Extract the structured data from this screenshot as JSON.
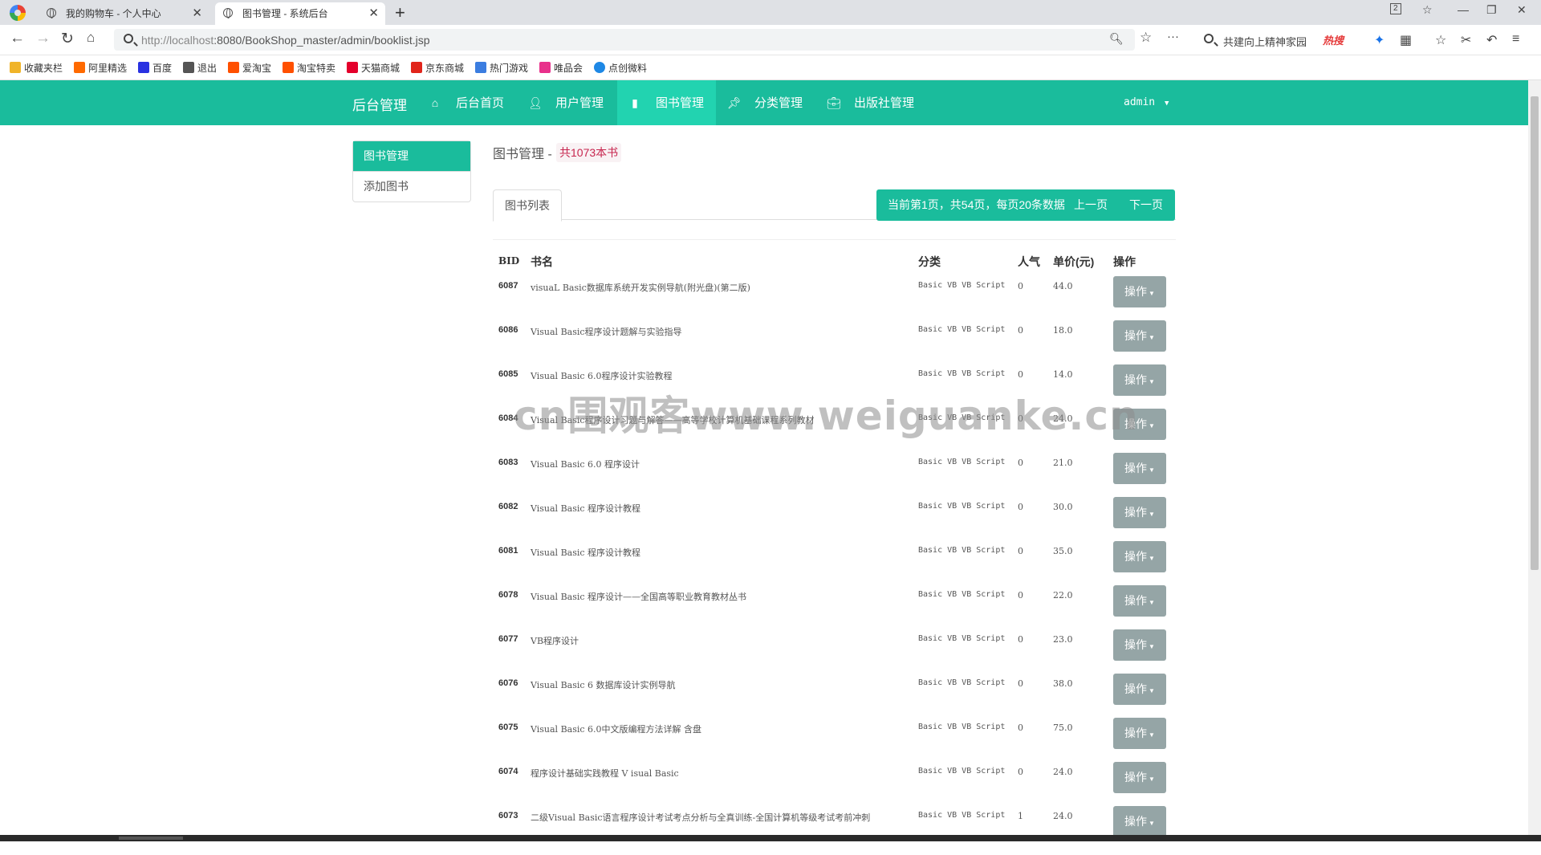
{
  "browser": {
    "tabs": [
      {
        "title": "我的购物车 - 个人中心",
        "active": false
      },
      {
        "title": "图书管理 - 系统后台",
        "active": true
      }
    ],
    "url_host": "http://localhost",
    "url_path": ":8080/BookShop_master/admin/booklist.jsp",
    "tab_count": "2",
    "search_hint": "共建向上精神家园",
    "hot_label": "热搜",
    "bookmarks": [
      {
        "label": "收藏夹栏",
        "color": "#f0b429"
      },
      {
        "label": "阿里精选",
        "color": "#ff6a00"
      },
      {
        "label": "百度",
        "color": "#2932e1"
      },
      {
        "label": "退出",
        "color": "#555555"
      },
      {
        "label": "爱淘宝",
        "color": "#ff5000"
      },
      {
        "label": "淘宝特卖",
        "color": "#ff5000"
      },
      {
        "label": "天猫商城",
        "color": "#e4002b"
      },
      {
        "label": "京东商城",
        "color": "#e1251b"
      },
      {
        "label": "热门游戏",
        "color": "#3b7de0"
      },
      {
        "label": "唯品会",
        "color": "#e8318b"
      },
      {
        "label": "点创微料",
        "color": "#1e88e5"
      }
    ]
  },
  "nav": {
    "brand": "后台管理",
    "items": [
      {
        "label": "后台首页",
        "icon": "home-icon"
      },
      {
        "label": "用户管理",
        "icon": "user-icon"
      },
      {
        "label": "图书管理",
        "icon": "book-icon"
      },
      {
        "label": "分类管理",
        "icon": "pushpin-icon"
      },
      {
        "label": "出版社管理",
        "icon": "briefcase-icon"
      }
    ],
    "user": "admin"
  },
  "sidebar": {
    "items": [
      {
        "label": "图书管理",
        "active": true
      },
      {
        "label": "添加图书",
        "active": false
      }
    ]
  },
  "main": {
    "title": "图书管理 -",
    "count": "共1073本书",
    "tab": "图书列表",
    "pager": {
      "info": "当前第1页，共54页，每页20条数据",
      "prev": "上一页",
      "next": "下一页"
    }
  },
  "table": {
    "headers": {
      "bid": "BID",
      "name": "书名",
      "category": "分类",
      "popularity": "人气",
      "price": "单价(元)",
      "op": "操作"
    },
    "op_label": "操作",
    "rows": [
      {
        "bid": "6087",
        "name": "visuaL Basic数据库系统开发实例导航(附光盘)(第二版)",
        "category": "Basic VB VB Script",
        "popularity": "0",
        "price": "44.0"
      },
      {
        "bid": "6086",
        "name": "Visual Basic程序设计题解与实验指导",
        "category": "Basic VB VB Script",
        "popularity": "0",
        "price": "18.0"
      },
      {
        "bid": "6085",
        "name": "Visual Basic 6.0程序设计实验教程",
        "category": "Basic VB VB Script",
        "popularity": "0",
        "price": "14.0"
      },
      {
        "bid": "6084",
        "name": "Visual Basic程序设计习题与解答——高等学校计算机基础课程系列教材",
        "category": "Basic VB VB Script",
        "popularity": "0",
        "price": "24.0"
      },
      {
        "bid": "6083",
        "name": "Visual Basic 6.0 程序设计",
        "category": "Basic VB VB Script",
        "popularity": "0",
        "price": "21.0"
      },
      {
        "bid": "6082",
        "name": "Visual Basic 程序设计教程",
        "category": "Basic VB VB Script",
        "popularity": "0",
        "price": "30.0"
      },
      {
        "bid": "6081",
        "name": "Visual Basic 程序设计教程",
        "category": "Basic VB VB Script",
        "popularity": "0",
        "price": "35.0"
      },
      {
        "bid": "6078",
        "name": "Visual Basic 程序设计——全国高等职业教育教材丛书",
        "category": "Basic VB VB Script",
        "popularity": "0",
        "price": "22.0"
      },
      {
        "bid": "6077",
        "name": "VB程序设计",
        "category": "Basic VB VB Script",
        "popularity": "0",
        "price": "23.0"
      },
      {
        "bid": "6076",
        "name": "Visual Basic 6 数据库设计实例导航",
        "category": "Basic VB VB Script",
        "popularity": "0",
        "price": "38.0"
      },
      {
        "bid": "6075",
        "name": "Visual Basic 6.0中文版编程方法详解 含盘",
        "category": "Basic VB VB Script",
        "popularity": "0",
        "price": "75.0"
      },
      {
        "bid": "6074",
        "name": "程序设计基础实践教程 V isual Basic",
        "category": "Basic VB VB Script",
        "popularity": "0",
        "price": "24.0"
      },
      {
        "bid": "6073",
        "name": "二级Visual Basic语言程序设计考试考点分析与全真训练-全国计算机等级考试考前冲刺",
        "category": "Basic VB VB Script",
        "popularity": "1",
        "price": "24.0"
      }
    ]
  },
  "watermark": "cn围观客www.weiguanke.cn",
  "colors": {
    "accent": "#1abc9c",
    "accent_active": "#22d3b0",
    "op_button": "#95a5a6"
  }
}
